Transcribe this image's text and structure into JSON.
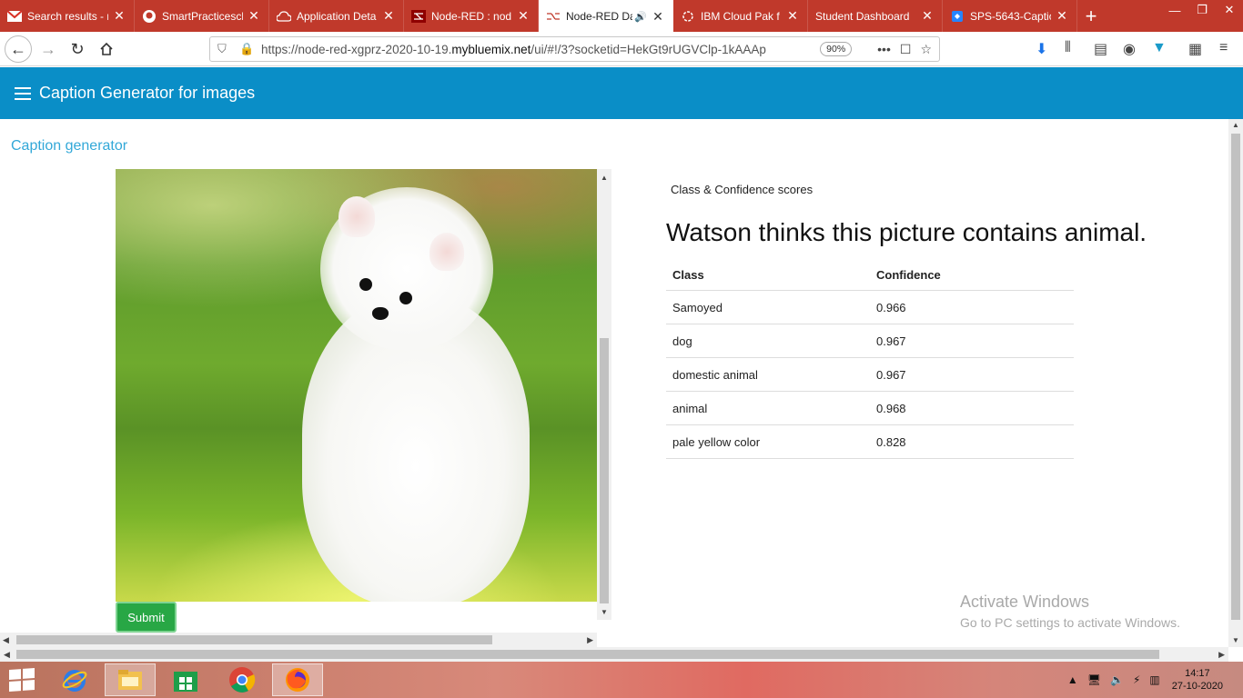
{
  "browser": {
    "tabs": [
      {
        "title": "Search results - n",
        "icon": "gmail-icon",
        "active": false
      },
      {
        "title": "SmartPracticesch",
        "icon": "github-icon",
        "active": false
      },
      {
        "title": "Application Deta",
        "icon": "cloud-icon",
        "active": false
      },
      {
        "title": "Node-RED : nod",
        "icon": "node-red-icon",
        "active": false
      },
      {
        "title": "Node-RED Da",
        "icon": "node-red-icon",
        "active": true
      },
      {
        "title": "IBM Cloud Pak f",
        "icon": "ibm-icon",
        "active": false
      },
      {
        "title": "Student Dashboard",
        "icon": "",
        "active": false
      },
      {
        "title": "SPS-5643-Captio",
        "icon": "jira-icon",
        "active": false
      }
    ],
    "url_prefix": "https://node-red-xgprz-2020-10-19.",
    "url_domain": "mybluemix.net",
    "url_suffix": "/ui/#!/3?socketid=HekGt9rUGVClp-1kAAAp",
    "zoom": "90%"
  },
  "app": {
    "title": "Caption Generator for images",
    "group_title": "Caption generator",
    "submit_label": "Submit",
    "panel_label": "Class & Confidence scores",
    "watson_text": "Watson thinks this picture contains animal.",
    "table": {
      "headers": [
        "Class",
        "Confidence"
      ],
      "rows": [
        [
          "Samoyed",
          "0.966"
        ],
        [
          "dog",
          "0.967"
        ],
        [
          "domestic animal",
          "0.967"
        ],
        [
          "animal",
          "0.968"
        ],
        [
          "pale yellow color",
          "0.828"
        ]
      ]
    }
  },
  "watermark": {
    "line1": "Activate Windows",
    "line2": "Go to PC settings to activate Windows."
  },
  "taskbar": {
    "time": "14:17",
    "date": "27-10-2020"
  },
  "colors": {
    "tab_strip": "#c0392b",
    "header": "#0a8ec7",
    "group_title": "#32a8d8",
    "submit": "#28a745"
  }
}
